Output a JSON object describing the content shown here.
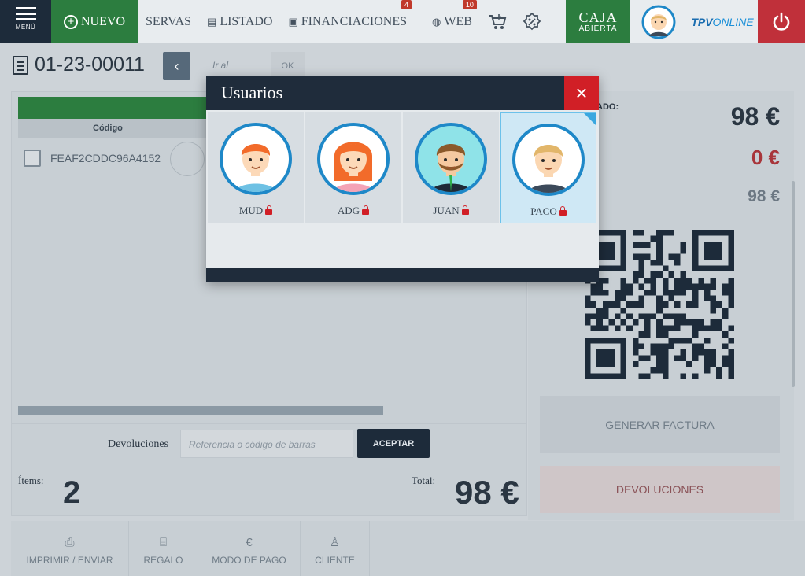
{
  "nav": {
    "menu_label": "MENÚ",
    "nuevo_label": "NUEVO",
    "reservas_label": "SERVAS",
    "listado_label": "LISTADO",
    "financiaciones_label": "FINANCIACIONES",
    "financiaciones_badge": "4",
    "web_label": "WEB",
    "web_badge": "10",
    "caja_title": "CAJA",
    "caja_status": "ABIERTA",
    "brand_bold": "TPV",
    "brand_rest": "ONLINE",
    "icons": [
      "menu-icon",
      "plus-circle-icon",
      "list-icon",
      "finance-icon",
      "www-icon",
      "cart-icon",
      "discount-icon",
      "avatar",
      "power-icon"
    ]
  },
  "doc": {
    "number": "01-23-00011",
    "goto_placeholder": "Ir al",
    "ok_label": "OK"
  },
  "table": {
    "column_codigo": "Código",
    "rows": [
      {
        "code": "FEAF2CDDC96A4152"
      }
    ]
  },
  "devoluciones": {
    "label": "Devoluciones",
    "placeholder": "Referencia o código de barras",
    "button": "ACEPTAR"
  },
  "summary": {
    "items_label": "Ítems:",
    "items_value": "2",
    "total_label": "Total:",
    "total_value": "98 €"
  },
  "footer": {
    "buttons": [
      {
        "label": "IMPRIMIR / ENVIAR",
        "icon": "printer-icon"
      },
      {
        "label": "REGALO",
        "icon": "gift-icon"
      },
      {
        "label": "MODO DE PAGO",
        "icon": "euro-icon"
      },
      {
        "label": "CLIENTE",
        "icon": "user-icon"
      }
    ]
  },
  "right": {
    "pagado_label": "ADO:",
    "amount_paid": "98 €",
    "amount_pending": "0 €",
    "amount_total": "98 €",
    "generar_factura": "GENERAR FACTURA",
    "devoluciones": "DEVOLUCIONES"
  },
  "modal": {
    "title": "Usuarios",
    "close_glyph": "×",
    "users": [
      {
        "name": "MUD",
        "hair": "#f26b2a",
        "skin": "#fcd9b8",
        "shirt": "#6ec1e4",
        "bg": "#ffffff",
        "selected": false
      },
      {
        "name": "ADG",
        "hair": "#f26b2a",
        "skin": "#fcd9b8",
        "shirt": "#f4a3b6",
        "bg": "#ffffff",
        "selected": false
      },
      {
        "name": "JUAN",
        "hair": "#8b5a2b",
        "skin": "#f5c9a0",
        "shirt": "#1f2a36",
        "bg": "#8fe3e8",
        "selected": false
      },
      {
        "name": "PACO",
        "hair": "#e2b66a",
        "skin": "#fbd7b2",
        "shirt": "#3c4a5a",
        "bg": "#ffffff",
        "selected": true
      }
    ]
  },
  "colors": {
    "navy": "#1f2c3b",
    "green": "#2c7d3f",
    "red": "#d11f26",
    "accent_blue": "#1e88c8"
  }
}
